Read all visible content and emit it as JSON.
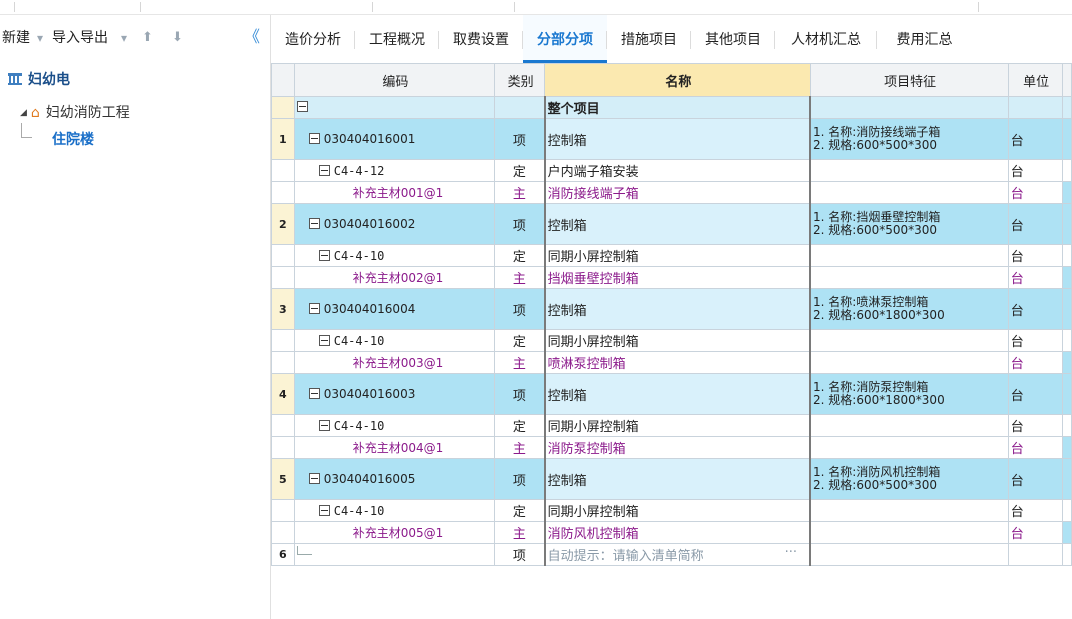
{
  "toolbar": {
    "new_label": "新建",
    "import_export_label": "导入导出",
    "dropdown_glyph": "▾",
    "up_glyph": "⬆",
    "down_glyph": "⬇",
    "collapse_glyph": "《"
  },
  "tree": {
    "root": "妇幼电",
    "project": "妇幼消防工程",
    "building": "住院楼"
  },
  "tabs": [
    "造价分析",
    "工程概况",
    "取费设置",
    "分部分项",
    "措施项目",
    "其他项目",
    "人材机汇总",
    "费用汇总"
  ],
  "active_tab": "分部分项",
  "columns": {
    "code": "编码",
    "type": "类别",
    "name": "名称",
    "feature": "项目特征",
    "unit": "单位"
  },
  "rows": [
    {
      "kind": "header",
      "num": "",
      "code": "",
      "type": "",
      "name": "整个项目",
      "feature": "",
      "unit": ""
    },
    {
      "kind": "q",
      "num": "1",
      "code": "030404016001",
      "type": "项",
      "name": "控制箱",
      "feature": "1. 名称:消防接线端子箱\n2. 规格:600*500*300",
      "unit": "台"
    },
    {
      "kind": "d",
      "num": "",
      "code": "C4-4-12",
      "type": "定",
      "name": "户内端子箱安装",
      "feature": "",
      "unit": "台"
    },
    {
      "kind": "m",
      "num": "",
      "code": "补充主材001@1",
      "type": "主",
      "name": "消防接线端子箱",
      "feature": "",
      "unit": "台"
    },
    {
      "kind": "q",
      "num": "2",
      "code": "030404016002",
      "type": "项",
      "name": "控制箱",
      "feature": "1. 名称:挡烟垂壁控制箱\n2. 规格:600*500*300",
      "unit": "台"
    },
    {
      "kind": "d",
      "num": "",
      "code": "C4-4-10",
      "type": "定",
      "name": "同期小屏控制箱",
      "feature": "",
      "unit": "台"
    },
    {
      "kind": "m",
      "num": "",
      "code": "补充主材002@1",
      "type": "主",
      "name": "挡烟垂壁控制箱",
      "feature": "",
      "unit": "台"
    },
    {
      "kind": "q",
      "num": "3",
      "code": "030404016004",
      "type": "项",
      "name": "控制箱",
      "feature": "1. 名称:喷淋泵控制箱\n2. 规格:600*1800*300",
      "unit": "台"
    },
    {
      "kind": "d",
      "num": "",
      "code": "C4-4-10",
      "type": "定",
      "name": "同期小屏控制箱",
      "feature": "",
      "unit": "台"
    },
    {
      "kind": "m",
      "num": "",
      "code": "补充主材003@1",
      "type": "主",
      "name": "喷淋泵控制箱",
      "feature": "",
      "unit": "台"
    },
    {
      "kind": "q",
      "num": "4",
      "code": "030404016003",
      "type": "项",
      "name": "控制箱",
      "feature": "1. 名称:消防泵控制箱\n2. 规格:600*1800*300",
      "unit": "台"
    },
    {
      "kind": "d",
      "num": "",
      "code": "C4-4-10",
      "type": "定",
      "name": "同期小屏控制箱",
      "feature": "",
      "unit": "台"
    },
    {
      "kind": "m",
      "num": "",
      "code": "补充主材004@1",
      "type": "主",
      "name": "消防泵控制箱",
      "feature": "",
      "unit": "台"
    },
    {
      "kind": "q",
      "num": "5",
      "code": "030404016005",
      "type": "项",
      "name": "控制箱",
      "feature": "1. 名称:消防风机控制箱\n2. 规格:600*500*300",
      "unit": "台"
    },
    {
      "kind": "d",
      "num": "",
      "code": "C4-4-10",
      "type": "定",
      "name": "同期小屏控制箱",
      "feature": "",
      "unit": "台"
    },
    {
      "kind": "m",
      "num": "",
      "code": "补充主材005@1",
      "type": "主",
      "name": "消防风机控制箱",
      "feature": "",
      "unit": "台"
    },
    {
      "kind": "new",
      "num": "6",
      "code": "",
      "type": "项",
      "name": "自动提示：请输入清单简称",
      "feature": "",
      "unit": "",
      "dots": "···"
    }
  ]
}
